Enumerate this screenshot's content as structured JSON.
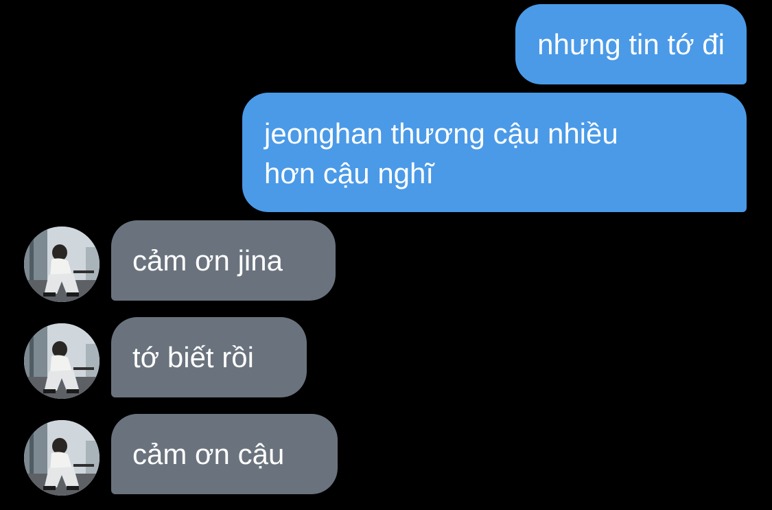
{
  "conversation": {
    "outgoing": [
      {
        "text": "nhưng tin tớ đi"
      },
      {
        "text": "jeonghan thương cậu nhiều\nhơn cậu nghĩ"
      }
    ],
    "incoming": [
      {
        "text": "cảm ơn jina",
        "avatar": "profile-photo"
      },
      {
        "text": "tớ biết rồi",
        "avatar": "profile-photo"
      },
      {
        "text": "cảm ơn cậu",
        "avatar": "profile-photo"
      }
    ]
  },
  "colors": {
    "background": "#000000",
    "outgoing_bubble": "#4a9ae8",
    "incoming_bubble": "#6a737d",
    "text": "#ffffff"
  }
}
